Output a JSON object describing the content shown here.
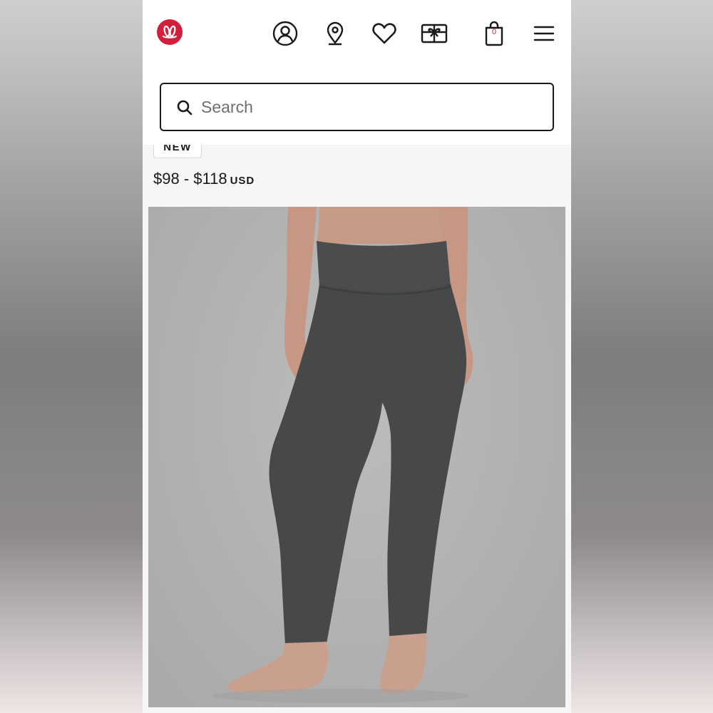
{
  "header": {
    "logo": "lululemon-logo",
    "icons": [
      "account-icon",
      "store-locator-icon",
      "wishlist-icon",
      "gift-card-icon",
      "shopping-bag-icon",
      "menu-icon"
    ],
    "bag_count": "0",
    "brand_color": "#d31f3b"
  },
  "search": {
    "placeholder": "Search"
  },
  "product": {
    "badge": "NEW",
    "price_range": "$98 - $118",
    "currency": "USD",
    "image": {
      "subject": "dark grey high-rise leggings on model",
      "background_color": "#b3b3b3",
      "garment_color": "#46484a"
    }
  }
}
